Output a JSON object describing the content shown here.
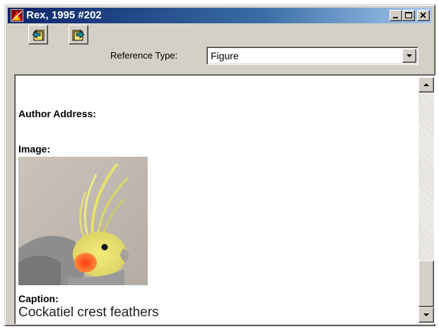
{
  "window": {
    "title": "Rex, 1995 #202",
    "controls": {
      "minimize_icon": "minimize-icon",
      "maximize_icon": "maximize-icon",
      "close_icon": "close-icon"
    }
  },
  "toolbar": {
    "prev_icon": "previous-reference-icon",
    "next_icon": "next-reference-icon",
    "reference_type_label": "Reference Type:",
    "reference_type_value": "Figure"
  },
  "record": {
    "author_address_label": "Author Address:",
    "image_label": "Image:",
    "image_description": "cockatiel-photo",
    "caption_label": "Caption:",
    "caption_value": "Cockatiel crest feathers"
  },
  "colors": {
    "titlebar_start": "#0a246a",
    "titlebar_end": "#a6caf0",
    "face": "#d4d0c8"
  }
}
